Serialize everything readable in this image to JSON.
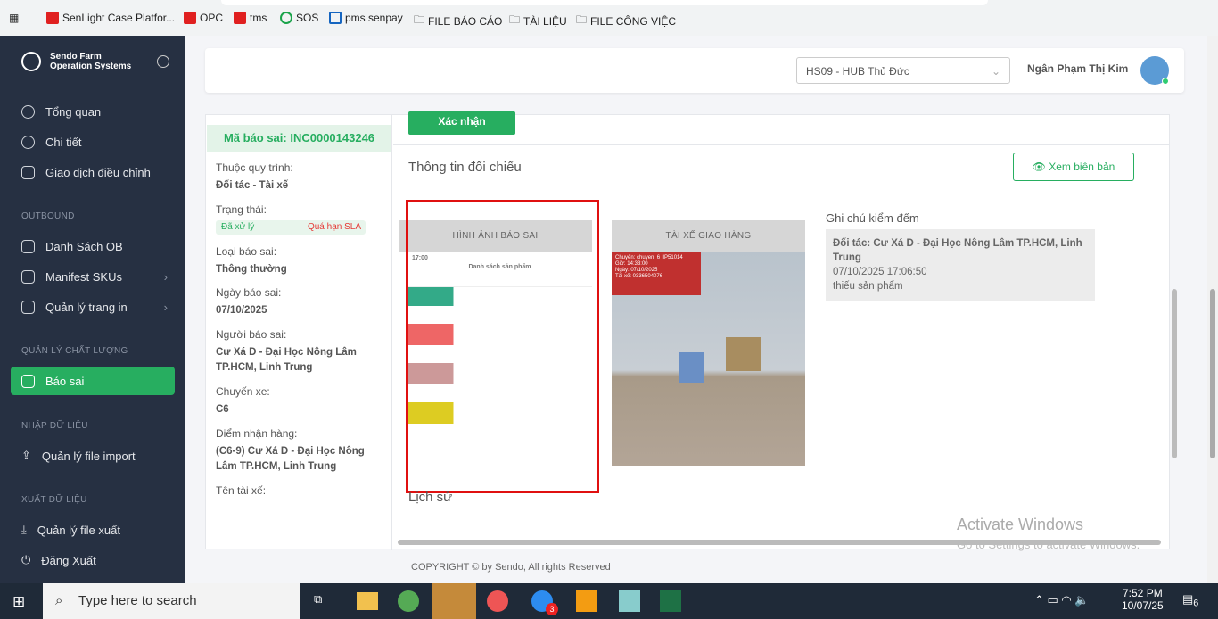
{
  "bookmarks": [
    {
      "label": "SenLight Case Platfor...",
      "icon": "sendo-icon"
    },
    {
      "label": "OPC",
      "icon": "sendo-icon"
    },
    {
      "label": "tms",
      "icon": "sendo-icon"
    },
    {
      "label": "SOS",
      "icon": "sos-icon"
    },
    {
      "label": "pms senpay",
      "icon": "p-icon"
    },
    {
      "label": "FILE BÁO CÁO",
      "icon": "folder-icon"
    },
    {
      "label": "TÀI LIỆU",
      "icon": "folder-icon"
    },
    {
      "label": "FILE CÔNG VIỆC",
      "icon": "folder-icon"
    }
  ],
  "sidebar": {
    "logo": "Sendo Farm",
    "logo2": "Operation Systems",
    "items": [
      "Tổng quan",
      "Chi tiết",
      "Giao dịch điều chỉnh",
      "Danh Sách OB",
      "Manifest SKUs",
      "Quản lý trang in",
      "Báo sai",
      "Quản lý file import",
      "Quản lý file xuất",
      "Đăng Xuất"
    ],
    "sections": [
      "OUTBOUND",
      "QUẢN LÝ CHẤT LƯỢNG",
      "NHẬP DỮ LIỆU",
      "XUẤT DỮ LIỆU"
    ]
  },
  "header": {
    "hub": "HS09 - HUB Thủ Đức",
    "user": "Ngân Phạm Thị Kim"
  },
  "detail": {
    "code": "Mã báo sai: INC0000143246",
    "process_label": "Thuộc quy trình:",
    "process": "Đối tác - Tài xế",
    "status_label": "Trạng thái:",
    "status": "Đã xử lý",
    "sla": "Quá hạn SLA",
    "type_label": "Loại báo sai:",
    "type": "Thông thường",
    "date_label": "Ngày báo sai:",
    "date": "07/10/2025",
    "reporter_label": "Người báo sai:",
    "reporter": "Cư Xá D - Đại Học Nông Lâm TP.HCM, Linh Trung",
    "trip_label": "Chuyến xe:",
    "trip": "C6",
    "point_label": "Điểm nhận hàng:",
    "point": "(C6-9) Cư Xá D - Đại Học Nông Lâm TP.HCM, Linh Trung",
    "driver_label": "Tên tài xế:"
  },
  "content": {
    "confirm": "Xác nhận",
    "section": "Thông tin đối chiếu",
    "view": "Xem biên bản",
    "photo1": "HÌNH ẢNH BÁO SAI",
    "photo2": "TÀI XẾ GIAO HÀNG",
    "phone_time": "17:00",
    "phone_title": "Danh sách sản phẩm",
    "overlay": [
      "Chuyến: chuyen_6_IP51014",
      "Giờ: 14:33:00",
      "Ngày: 07/10/2025",
      "Tài xế: 0336504076"
    ],
    "note_title": "Ghi chú kiểm đếm",
    "note_partner": "Đối tác: Cư Xá D - Đại Học Nông Lâm TP.HCM, Linh Trung",
    "note_time": "07/10/2025 17:06:50",
    "note_text": "thiếu sản phẩm",
    "history": "Lịch sử"
  },
  "footer": "COPYRIGHT © by Sendo, All rights Reserved",
  "watermark": {
    "title": "Activate Windows",
    "sub": "Go to Settings to activate Windows."
  },
  "taskbar": {
    "search": "Type here to search",
    "time": "7:52 PM",
    "date": "10/07/25",
    "notif": "6",
    "zalo_badge": "3"
  }
}
